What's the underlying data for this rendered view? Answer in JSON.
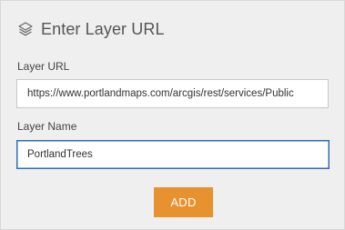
{
  "header": {
    "icon": "layers-icon",
    "title": "Enter Layer URL"
  },
  "form": {
    "layer_url": {
      "label": "Layer URL",
      "value": "https://www.portlandmaps.com/arcgis/rest/services/Public"
    },
    "layer_name": {
      "label": "Layer Name",
      "value": "PortlandTrees"
    },
    "add_button_label": "ADD"
  },
  "colors": {
    "accent_button": "#e8912f",
    "focus_border": "#2f6db3",
    "panel_background": "#efefef"
  }
}
